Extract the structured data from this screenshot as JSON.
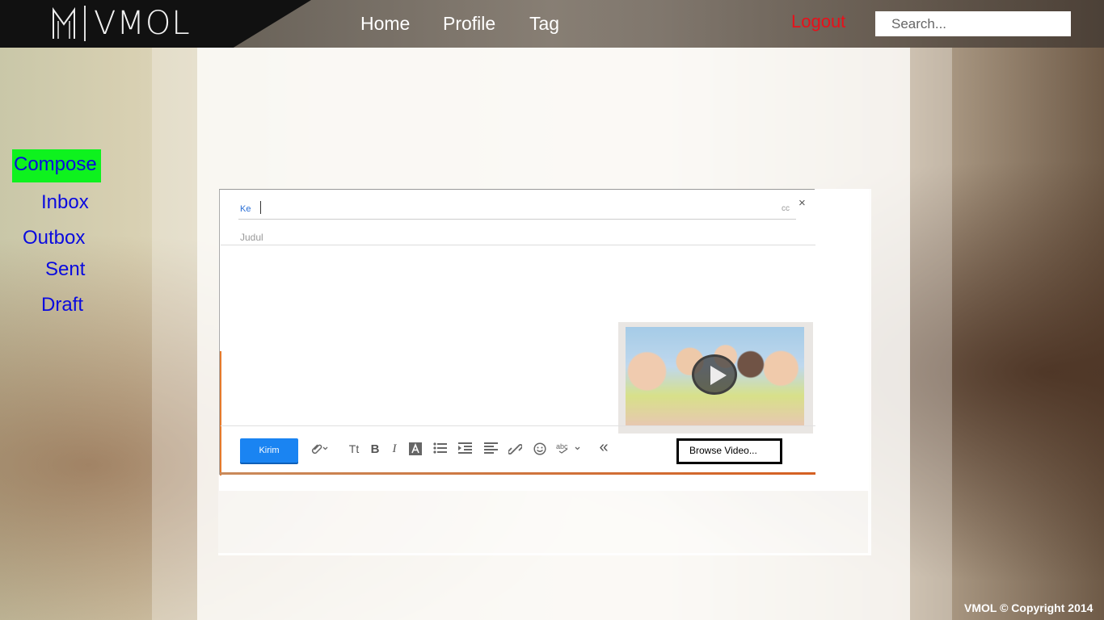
{
  "header": {
    "brand": "VMOL",
    "nav": [
      "Home",
      "Profile",
      "Tag"
    ],
    "logout": "Logout",
    "search_placeholder": "Search..."
  },
  "sidebar": {
    "items": [
      {
        "label": "Compose",
        "active": true
      },
      {
        "label": "Inbox"
      },
      {
        "label": "Outbox"
      },
      {
        "label": "Sent"
      },
      {
        "label": "Draft"
      }
    ]
  },
  "compose": {
    "to_label": "Ke",
    "cc_label": "cc",
    "close": "×",
    "subject_placeholder": "Judul",
    "send_label": "Kirim",
    "browse_label": "Browse Video...",
    "toolbar_icons": [
      "attach-icon",
      "font-size-icon",
      "bold-icon",
      "italic-icon",
      "text-color-icon",
      "bullet-list-icon",
      "indent-icon",
      "align-icon",
      "link-icon",
      "emoji-icon",
      "spellcheck-icon",
      "collapse-icon"
    ]
  },
  "footer": {
    "copyright": "VMOL © Copyright 2014"
  },
  "colors": {
    "compose_highlight": "#0ef21e",
    "sidebar_link": "#0a0adf",
    "logout": "#e8101a",
    "send_button": "#1a84f2"
  }
}
